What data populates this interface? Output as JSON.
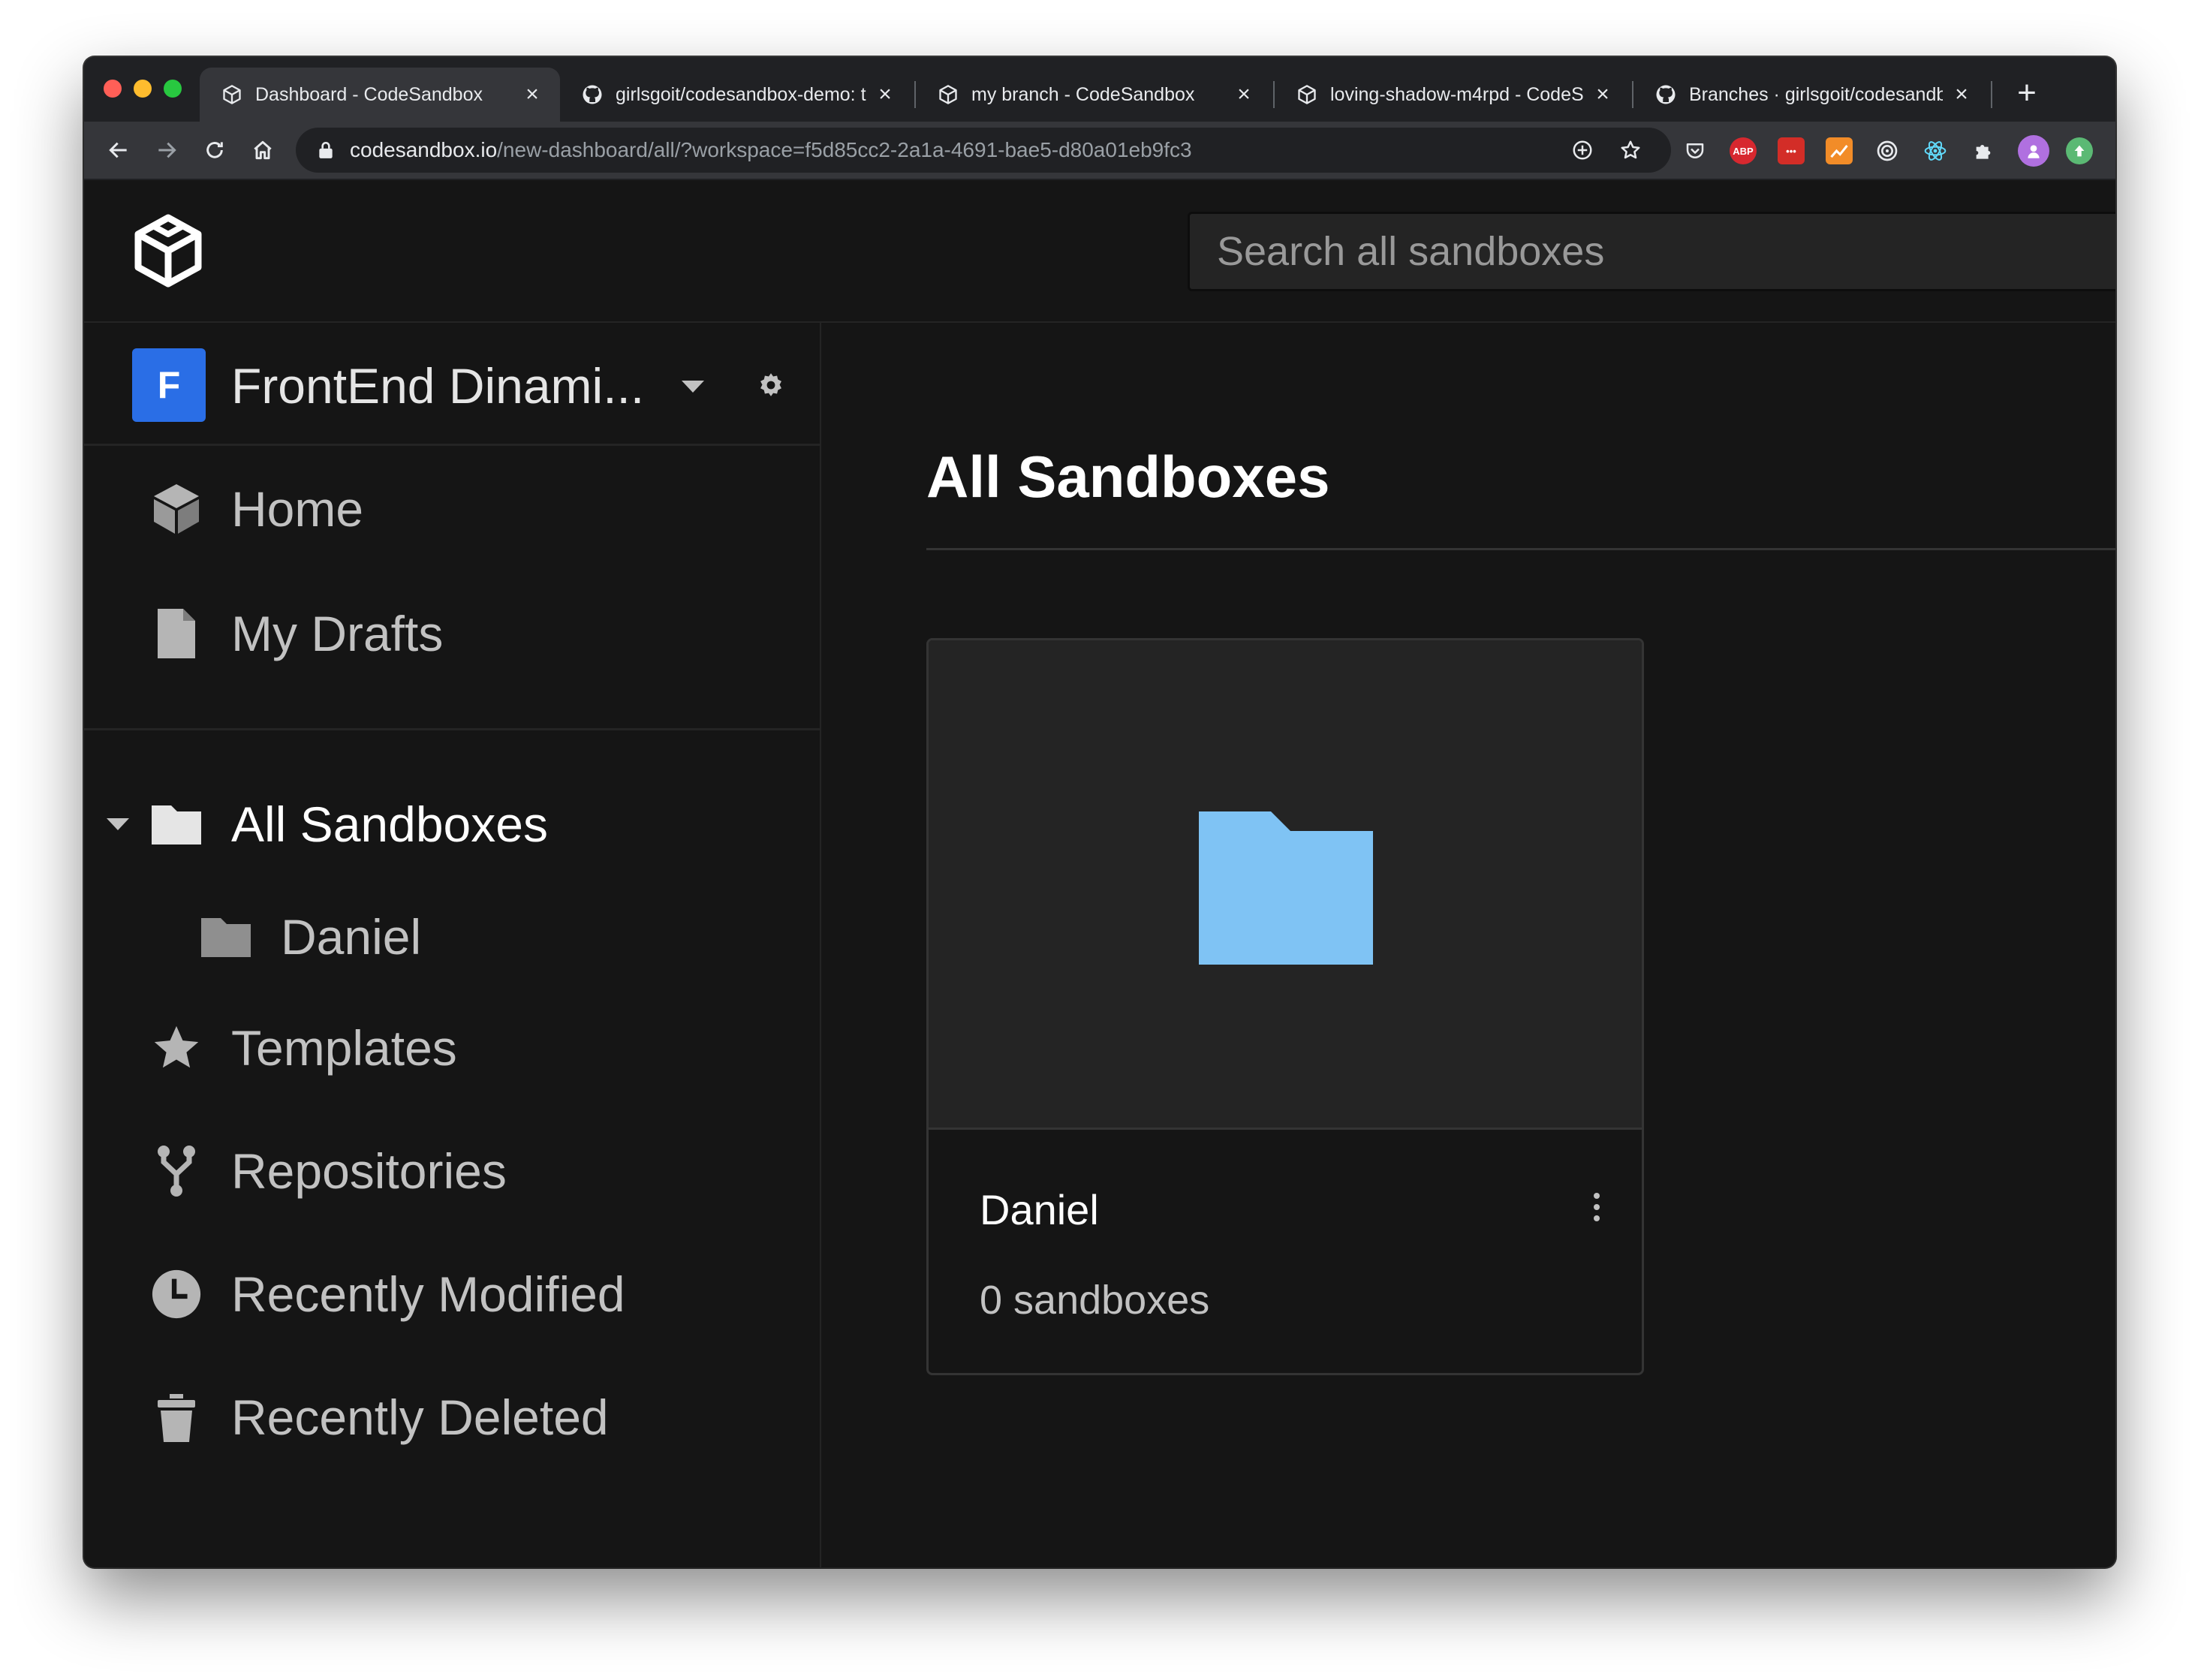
{
  "browser": {
    "tabs": [
      {
        "title": "Dashboard - CodeSandbox",
        "icon": "codesandbox-icon",
        "active": true
      },
      {
        "title": "girlsgoit/codesandbox-demo: t",
        "icon": "github-icon",
        "active": false
      },
      {
        "title": "my branch - CodeSandbox",
        "icon": "codesandbox-icon",
        "active": false
      },
      {
        "title": "loving-shadow-m4rpd - CodeS",
        "icon": "codesandbox-icon",
        "active": false
      },
      {
        "title": "Branches · girlsgoit/codesandb",
        "icon": "github-icon",
        "active": false
      }
    ],
    "url_host": "codesandbox.io",
    "url_path": "/new-dashboard/all/?workspace=f5d85cc2-2a1a-4691-bae5-d80a01eb9fc3",
    "extensions": [
      {
        "name": "pocket-icon",
        "color": "#35363a"
      },
      {
        "name": "adblock-icon",
        "label": "ABP",
        "color": "#d7282f"
      },
      {
        "name": "lastpass-icon",
        "label": "•••",
        "color": "#d32d27"
      },
      {
        "name": "chart-extension-icon",
        "color": "#f28c28"
      },
      {
        "name": "target-extension-icon",
        "color": "#35363a"
      },
      {
        "name": "react-devtools-icon",
        "color": "#35363a"
      },
      {
        "name": "extensions-puzzle-icon",
        "color": "#35363a"
      },
      {
        "name": "profile-avatar",
        "color": "#b070e0"
      },
      {
        "name": "update-icon",
        "color": "#5bb974"
      }
    ]
  },
  "header": {
    "search_placeholder": "Search all sandboxes"
  },
  "sidebar": {
    "workspace": {
      "initial": "F",
      "name": "FrontEnd Dinami..."
    },
    "items": [
      {
        "label": "Home",
        "icon": "box-icon"
      },
      {
        "label": "My Drafts",
        "icon": "file-icon"
      },
      {
        "label": "All Sandboxes",
        "icon": "folder-icon"
      },
      {
        "label": "Daniel",
        "icon": "folder-icon"
      },
      {
        "label": "Templates",
        "icon": "star-icon"
      },
      {
        "label": "Repositories",
        "icon": "fork-icon"
      },
      {
        "label": "Recently Modified",
        "icon": "clock-icon"
      },
      {
        "label": "Recently Deleted",
        "icon": "trash-icon"
      }
    ]
  },
  "main": {
    "title": "All Sandboxes",
    "folders": [
      {
        "name": "Daniel",
        "count": "0 sandboxes",
        "color": "#7fc3f4"
      }
    ]
  }
}
